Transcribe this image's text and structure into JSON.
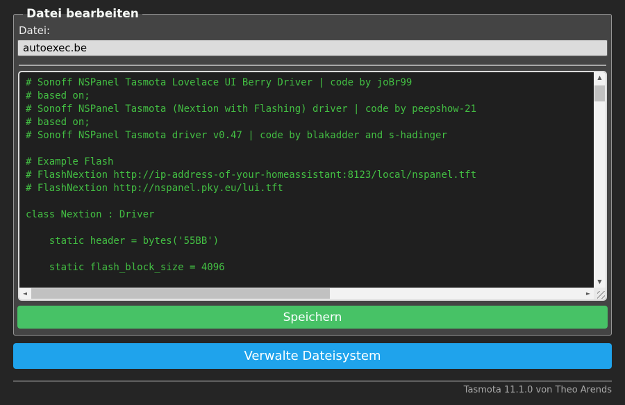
{
  "colors": {
    "page_background": "#252525",
    "form_background": "#444444",
    "text": "#eaeaea",
    "input_background": "#dcdcdc",
    "input_text": "#000000",
    "editor_background": "#1f1f1f",
    "editor_text": "#43bf43",
    "save_button": "#47c266",
    "manage_button": "#1fa3ec",
    "button_text": "#faffff",
    "footer_text": "#a9a9a9"
  },
  "panel": {
    "legend": "Datei bearbeiten",
    "file_label": "Datei:",
    "file_value": "autoexec.be",
    "editor_lines": [
      "# Sonoff NSPanel Tasmota Lovelace UI Berry Driver | code by joBr99",
      "# based on;",
      "# Sonoff NSPanel Tasmota (Nextion with Flashing) driver | code by peepshow-21",
      "# based on;",
      "# Sonoff NSPanel Tasmota driver v0.47 | code by blakadder and s-hadinger",
      "",
      "# Example Flash",
      "# FlashNextion http://ip-address-of-your-homeassistant:8123/local/nspanel.tft",
      "# FlashNextion http://nspanel.pky.eu/lui.tft",
      "",
      "class Nextion : Driver",
      "",
      "    static header = bytes('55BB')",
      "",
      "    static flash_block_size = 4096"
    ],
    "save_button_label": "Speichern"
  },
  "manage_button_label": "Verwalte Dateisystem",
  "footer": {
    "text": "Tasmota 11.1.0 von Theo Arends"
  },
  "icons": {
    "scroll_up": "▲",
    "scroll_down": "▼",
    "scroll_left": "◄",
    "scroll_right": "►"
  }
}
